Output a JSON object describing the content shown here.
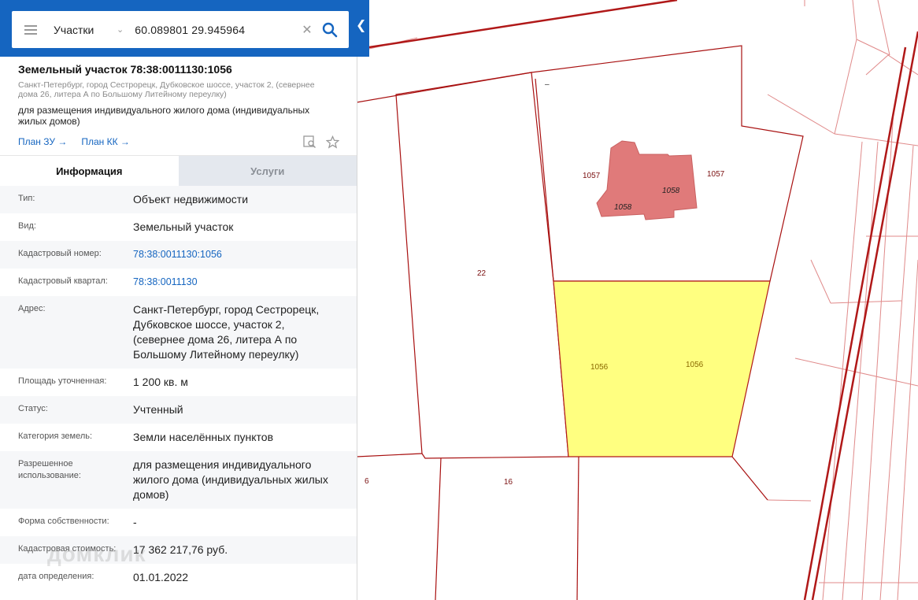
{
  "search": {
    "layer": "Участки",
    "query": "60.089801 29.945964"
  },
  "map": {
    "selected_fill": "#ffff80",
    "building_fill": "#e07a7a",
    "boundary_color": "#b01818",
    "labels": {
      "p22": "22",
      "p1057a": "1057",
      "p1057b": "1057",
      "b1058a": "1058",
      "b1058b": "1058",
      "s1056a": "1056",
      "s1056b": "1056",
      "p6": "6",
      "p16": "16"
    }
  },
  "card": {
    "title": "Земельный участок 78:38:0011130:1056",
    "address_line1": "Санкт-Петербург, город Сестрорецк, Дубковское шоссе, участок 2, (севернее",
    "address_line2": "дома 26, литера А по Большому Литейному переулку)",
    "purpose_line1": "для размещения индивидуального жилого дома (индивидуальных",
    "purpose_line2": "жилых домов)",
    "link_plan_zu": "План ЗУ →",
    "link_plan_kk": "План КК →"
  },
  "tabs": {
    "info": "Информация",
    "services": "Услуги"
  },
  "fields": {
    "type_k": "Тип:",
    "type_v": "Объект недвижимости",
    "kind_k": "Вид:",
    "kind_v": "Земельный участок",
    "cadnum_k": "Кадастровый номер:",
    "cadnum_v": "78:38:0011130:1056",
    "quarter_k": "Кадастровый квартал:",
    "quarter_v": "78:38:0011130",
    "addr_k": "Адрес:",
    "addr_v1": "Санкт-Петербург, город Сестрорецк,",
    "addr_v2": "Дубковское шоссе, участок 2,",
    "addr_v3": "(севернее дома 26, литера А по",
    "addr_v4": "Большому Литейному переулку)",
    "area_k": "Площадь уточненная:",
    "area_v": "1 200 кв. м",
    "status_k": "Статус:",
    "status_v": "Учтенный",
    "cat_k": "Категория земель:",
    "cat_v": "Земли населённых пунктов",
    "use_k1": "Разрешенное",
    "use_k2": "использование:",
    "use_v1": "для размещения индивидуального",
    "use_v2": "жилого дома (индивидуальных жилых",
    "use_v3": "домов)",
    "own_k": "Форма собственности:",
    "own_v": "-",
    "cost_k": "Кадастровая стоимость:",
    "cost_v": "17 362 217,76 руб.",
    "date_k": "дата определения:",
    "date_v": "01.01.2022"
  },
  "watermark": "домклик"
}
